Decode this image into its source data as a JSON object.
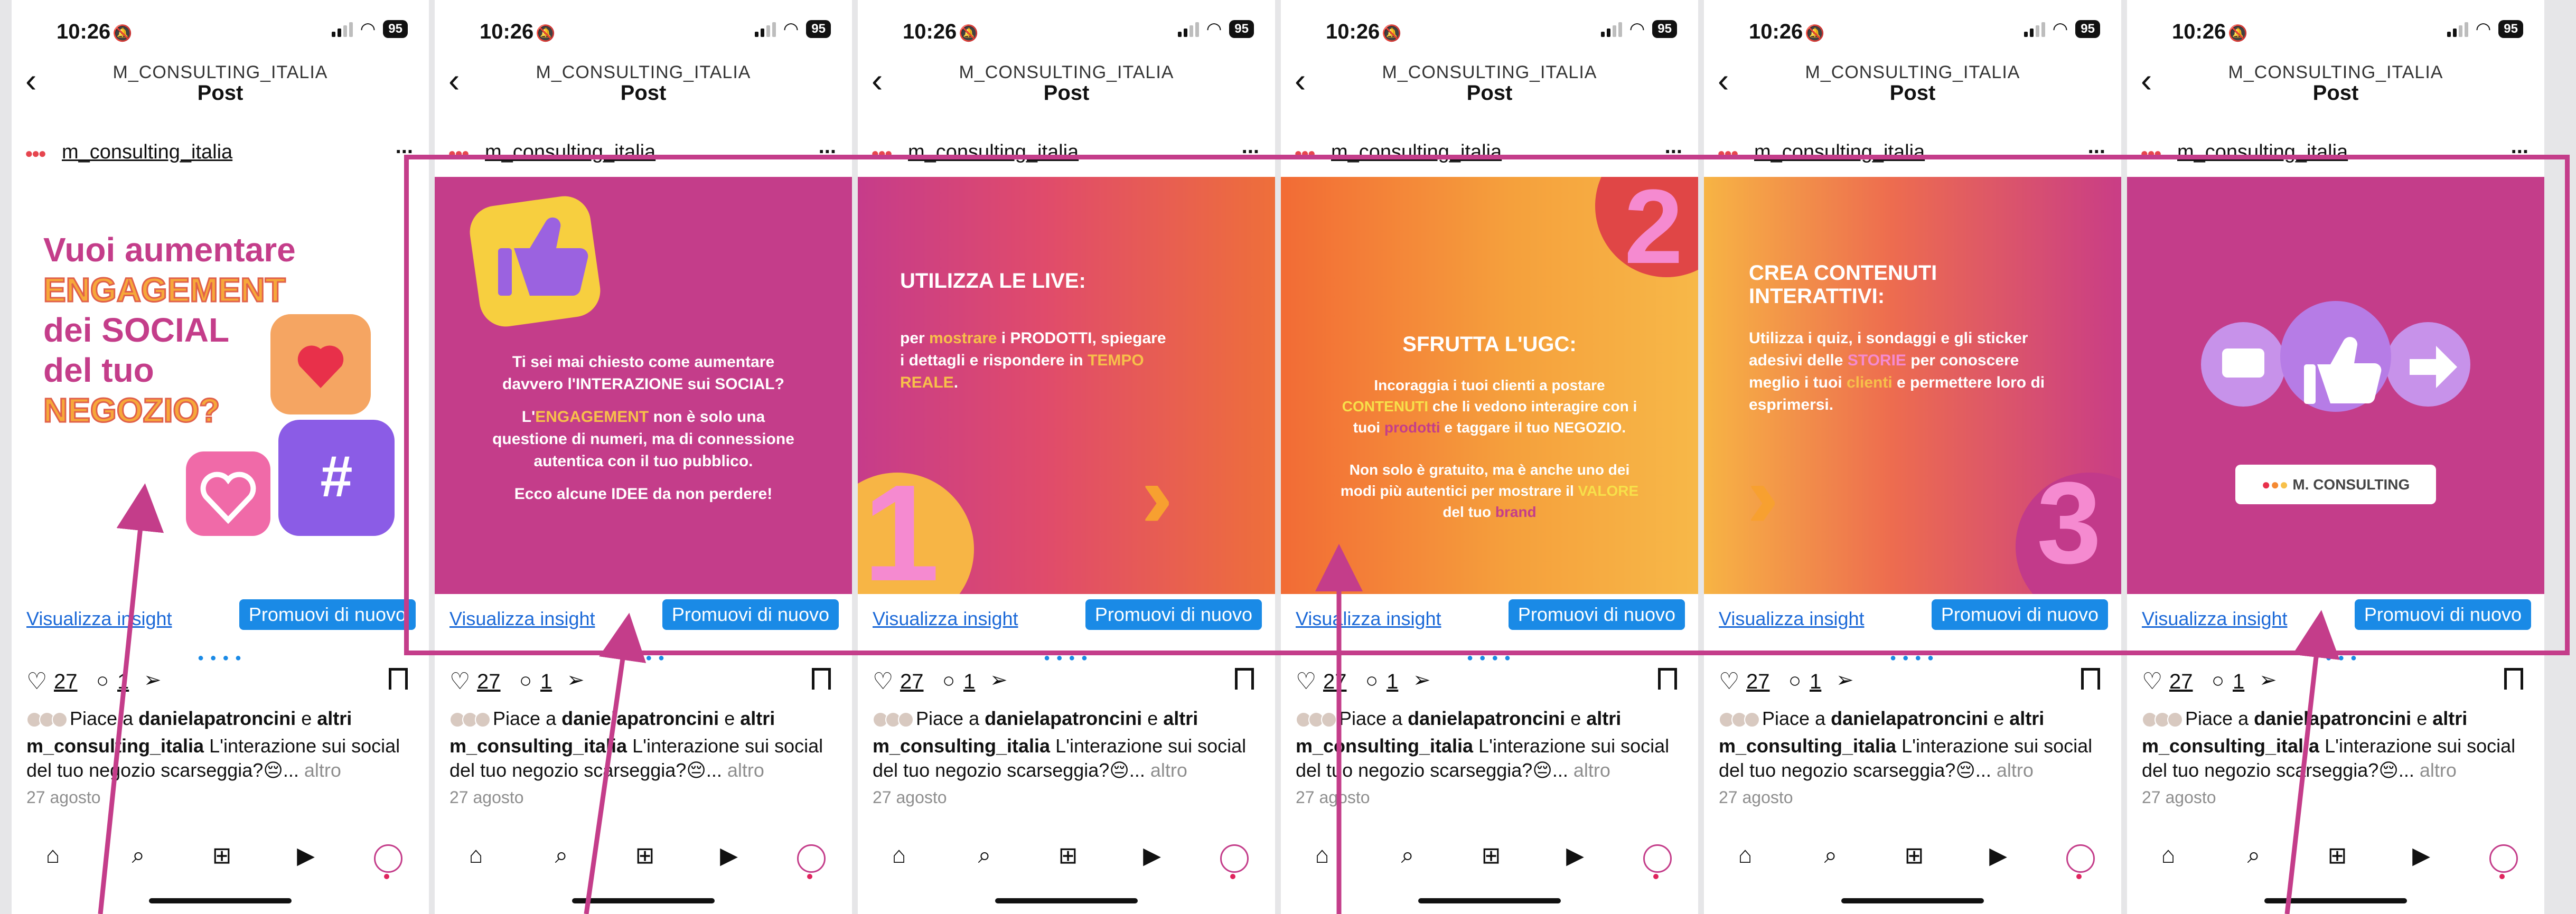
{
  "status": {
    "time": "10:26",
    "battery": "95"
  },
  "navbar": {
    "account": "M_CONSULTING_ITALIA",
    "title": "Post"
  },
  "author": {
    "username": "m_consulting_italia",
    "more": "..."
  },
  "actions": {
    "insight": "Visualizza insight",
    "promote": "Promuovi di nuovo"
  },
  "engagement": {
    "likes": "27",
    "comments": "1"
  },
  "liked_by": {
    "prefix": "Piace a",
    "user": "danielapatroncini",
    "conj": "e",
    "others": "altri"
  },
  "caption": {
    "user": "m_consulting_italia",
    "text": " L'interazione sui social del tuo negozio scarseggia?😔... ",
    "more": "altro"
  },
  "date": "27 agosto",
  "slides": {
    "s1": {
      "l1": "Vuoi aumentare",
      "l2": "ENGAGEMENT",
      "l3": "dei SOCIAL",
      "l4": "del tuo",
      "l5": "NEGOZIO?"
    },
    "s2": {
      "p1": "Ti sei mai chiesto come aumentare davvero l'INTERAZIONE sui SOCIAL?",
      "p2a": "L'",
      "p2b": "ENGAGEMENT",
      "p2c": " non è solo una questione di numeri, ma di connessione autentica con il tuo pubblico.",
      "p3": "Ecco alcune IDEE da non perdere!"
    },
    "s3": {
      "title": "UTILIZZA LE LIVE:",
      "a": "per ",
      "b": "mostrare",
      "c": " i PRODOTTI, spiegare i dettagli e rispondere in ",
      "d": "TEMPO REALE",
      "e": ".",
      "num": "1"
    },
    "s4": {
      "num": "2",
      "title": "SFRUTTA L'UGC:",
      "a": "Incoraggia i tuoi clienti a postare ",
      "b": "CONTENUTI",
      "c": " che li vedono interagire con i tuoi ",
      "d": "prodotti",
      "e": " e taggare il tuo NEGOZIO.",
      "f": "Non solo è gratuito, ma è anche uno dei modi più autentici per mostrare il ",
      "g": "VALORE",
      "h": " del tuo ",
      "i": "brand"
    },
    "s5": {
      "title": "CREA CONTENUTI INTERATTIVI:",
      "a": "Utilizza i quiz, i sondaggi e gli sticker adesivi delle ",
      "b": "STORIE",
      "c": " per conoscere meglio i tuoi ",
      "d": "clienti",
      "e": " e permettere loro di esprimersi.",
      "num": "3"
    },
    "s6": {
      "logo": "M. CONSULTING"
    }
  },
  "colors": {
    "magenta": "#c43d8a",
    "orange": "#f58a32",
    "blue": "#1a8ae6"
  }
}
